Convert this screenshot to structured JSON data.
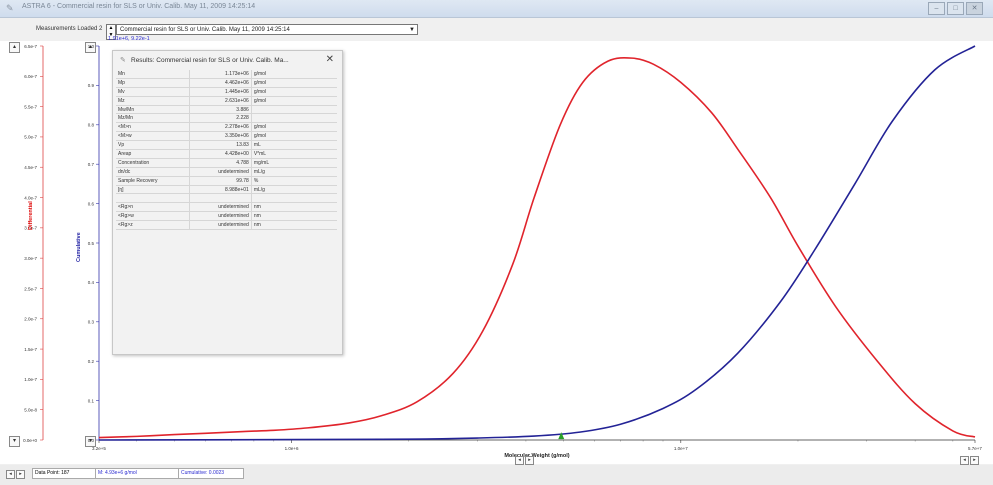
{
  "window": {
    "title": "ASTRA 6 - Commercial resin for SLS or Univ. Calib. May 11, 2009 14:25:14",
    "controls": [
      "–",
      "□",
      "✕"
    ]
  },
  "toolbar": {
    "measurements_label": "Measurements Loaded 2",
    "selected_measurement": "Commercial resin for SLS or Univ. Calib. May 11, 2009 14:25:14"
  },
  "marker_label": "1.91e+6, 9.22e-1",
  "results_panel": {
    "title": "Results: Commercial resin for SLS or Univ. Calib. Ma...",
    "rows": [
      {
        "name": "Mn",
        "value": "1.173e+06",
        "unit": "g/mol"
      },
      {
        "name": "Mp",
        "value": "4.462e+06",
        "unit": "g/mol"
      },
      {
        "name": "Mv",
        "value": "1.445e+06",
        "unit": "g/mol"
      },
      {
        "name": "Mz",
        "value": "2.631e+06",
        "unit": "g/mol"
      },
      {
        "name": "Mw/Mn",
        "value": "3.886",
        "unit": ""
      },
      {
        "name": "Mz/Mn",
        "value": "2.228",
        "unit": ""
      },
      {
        "name": "<M>n",
        "value": "2.278e+06",
        "unit": "g/mol"
      },
      {
        "name": "<M>w",
        "value": "3.350e+06",
        "unit": "g/mol"
      },
      {
        "name": "Vp",
        "value": "13.83",
        "unit": "mL"
      },
      {
        "name": "Areap",
        "value": "4.428e+00",
        "unit": "V*mL"
      },
      {
        "name": "Concentration",
        "value": "4.788",
        "unit": "mg/mL"
      },
      {
        "name": "dn/dc",
        "value": "undetermined",
        "unit": "mL/g"
      },
      {
        "name": "Sample Recovery",
        "value": "99.78",
        "unit": "%"
      },
      {
        "name": "[η]",
        "value": "8.988e+01",
        "unit": "mL/g"
      },
      {
        "name": "",
        "value": "",
        "unit": ""
      },
      {
        "name": "<Rg>n",
        "value": "undetermined",
        "unit": "nm"
      },
      {
        "name": "<Rg>w",
        "value": "undetermined",
        "unit": "nm"
      },
      {
        "name": "<Rg>z",
        "value": "undetermined",
        "unit": "nm"
      }
    ]
  },
  "status": {
    "data_point": "Data Point: 187",
    "mw": "M: 4.93e+6 g/mol",
    "cumulative": "Cumulative: 0.0023"
  },
  "colors": {
    "differential": "#e0242c",
    "cumulative": "#232396"
  },
  "chart_data": {
    "type": "line",
    "xlabel": "Molecular Weight (g/mol)",
    "x_scale": "log",
    "xlim": [
      320000,
      57000000
    ],
    "x_ticks": [
      {
        "v": 320000,
        "label": "3.2e+5"
      },
      {
        "v": 1000000,
        "label": "1.0e+6"
      },
      {
        "v": 10000000,
        "label": "1.0e+7"
      },
      {
        "v": 57000000,
        "label": "5.7e+7"
      }
    ],
    "y_left": {
      "label": "Differential",
      "lim": [
        0,
        6.5e-07
      ],
      "ticks": [
        "0.0e+0",
        "5.0e-8",
        "1.0e-7",
        "1.5e-7",
        "2.0e-7",
        "2.5e-7",
        "3.0e-7",
        "3.5e-7",
        "4.0e-7",
        "4.5e-7",
        "5.0e-7",
        "5.5e-7",
        "6.0e-7",
        "6.5e-7"
      ]
    },
    "y_right": {
      "label": "Cumulative",
      "lim": [
        0,
        1.0
      ],
      "ticks": [
        "0.0",
        "0.1",
        "0.2",
        "0.3",
        "0.4",
        "0.5",
        "0.6",
        "0.7",
        "0.8",
        "0.9",
        "1.0"
      ]
    },
    "series": [
      {
        "name": "Differential",
        "axis": "left",
        "x": [
          320000,
          400000,
          500000,
          600000,
          750000,
          900000,
          1100000,
          1400000,
          1700000,
          2100000,
          2600000,
          3100000,
          3700000,
          4200000,
          4900000,
          5600000,
          6500000,
          7500000,
          8500000,
          10000000,
          12000000,
          14000000,
          17000000,
          20000000,
          25000000,
          32000000,
          40000000,
          50000000,
          57000000
        ],
        "y": [
          4e-09,
          6e-09,
          9e-09,
          1.1e-08,
          1.4e-08,
          1.6e-08,
          2e-08,
          2.8e-08,
          4e-08,
          6.3e-08,
          1.1e-07,
          1.8e-07,
          2.9e-07,
          4e-07,
          5.2e-07,
          5.9e-07,
          6.25e-07,
          6.3e-07,
          6.2e-07,
          5.9e-07,
          5.4e-07,
          4.8e-07,
          4e-07,
          3.2e-07,
          2.2e-07,
          1.3e-07,
          6e-08,
          1.5e-08,
          5e-09
        ]
      },
      {
        "name": "Cumulative",
        "axis": "right",
        "x": [
          320000,
          1000000,
          2000000,
          3000000,
          4200000,
          5500000,
          7000000,
          9000000,
          11000000,
          14000000,
          18000000,
          22000000,
          28000000,
          35000000,
          45000000,
          57000000
        ],
        "y": [
          0.0,
          0.001,
          0.002,
          0.005,
          0.01,
          0.02,
          0.04,
          0.08,
          0.13,
          0.22,
          0.35,
          0.48,
          0.65,
          0.81,
          0.94,
          1.0
        ]
      }
    ],
    "marker": {
      "x": 4930000,
      "y": 0.0023
    }
  }
}
